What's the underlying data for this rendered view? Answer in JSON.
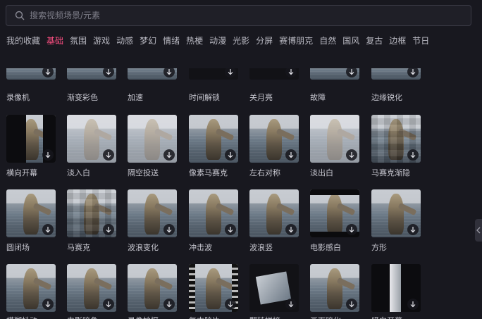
{
  "search": {
    "placeholder": "搜索视频场景/元素"
  },
  "tabs": [
    {
      "label": "我的收藏",
      "active": false
    },
    {
      "label": "基础",
      "active": true
    },
    {
      "label": "氛围",
      "active": false
    },
    {
      "label": "游戏",
      "active": false
    },
    {
      "label": "动感",
      "active": false
    },
    {
      "label": "梦幻",
      "active": false
    },
    {
      "label": "情绪",
      "active": false
    },
    {
      "label": "热梗",
      "active": false
    },
    {
      "label": "动漫",
      "active": false
    },
    {
      "label": "光影",
      "active": false
    },
    {
      "label": "分屏",
      "active": false
    },
    {
      "label": "赛博朋克",
      "active": false
    },
    {
      "label": "自然",
      "active": false
    },
    {
      "label": "国风",
      "active": false
    },
    {
      "label": "复古",
      "active": false
    },
    {
      "label": "边框",
      "active": false
    },
    {
      "label": "节日",
      "active": false
    }
  ],
  "effects": [
    [
      {
        "label": "录像机",
        "style": "normal"
      },
      {
        "label": "渐变彩色",
        "style": "normal"
      },
      {
        "label": "加速",
        "style": "normal"
      },
      {
        "label": "时间解锁",
        "style": "dark"
      },
      {
        "label": "关月亮",
        "style": "dark"
      },
      {
        "label": "故障",
        "style": "normal"
      },
      {
        "label": "边缘锐化",
        "style": "normal"
      }
    ],
    [
      {
        "label": "横向开幕",
        "style": "curtain"
      },
      {
        "label": "淡入白",
        "style": "white"
      },
      {
        "label": "隔空投送",
        "style": "white"
      },
      {
        "label": "像素马赛克",
        "style": "normal"
      },
      {
        "label": "左右对称",
        "style": "normal"
      },
      {
        "label": "淡出白",
        "style": "white"
      },
      {
        "label": "马赛克渐隐",
        "style": "pixel"
      }
    ],
    [
      {
        "label": "圆闭场",
        "style": "normal"
      },
      {
        "label": "马赛克",
        "style": "pixel"
      },
      {
        "label": "波浪变化",
        "style": "normal"
      },
      {
        "label": "冲击波",
        "style": "normal"
      },
      {
        "label": "波浪竖",
        "style": "normal"
      },
      {
        "label": "电影感白",
        "style": "bands"
      },
      {
        "label": "方形",
        "style": "normal"
      }
    ],
    [
      {
        "label": "模糊抖动",
        "style": "normal"
      },
      {
        "label": "电影暗角",
        "style": "normal"
      },
      {
        "label": "录像拍摄",
        "style": "normal"
      },
      {
        "label": "复古胶片",
        "style": "film"
      },
      {
        "label": "翻转拼接",
        "style": "dark"
      },
      {
        "label": "画面暗化",
        "style": "normal"
      },
      {
        "label": "竖向开幕",
        "style": "curtain2"
      }
    ]
  ]
}
